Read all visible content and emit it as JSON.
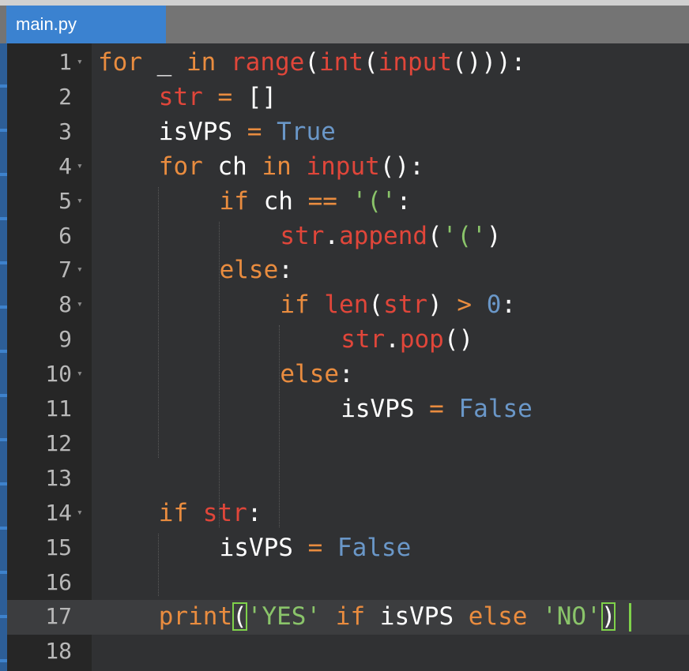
{
  "editor": {
    "tab": {
      "label": "main.py"
    },
    "lines": [
      {
        "number": "1",
        "fold": true,
        "indent": 0,
        "tokens": [
          {
            "t": "for",
            "c": "kw"
          },
          {
            "t": " _ ",
            "c": "pl"
          },
          {
            "t": "in",
            "c": "kw"
          },
          {
            "t": " ",
            "c": "pl"
          },
          {
            "t": "range",
            "c": "bi"
          },
          {
            "t": "(",
            "c": "pl"
          },
          {
            "t": "int",
            "c": "bi"
          },
          {
            "t": "(",
            "c": "pl"
          },
          {
            "t": "input",
            "c": "bi"
          },
          {
            "t": "())):",
            "c": "pl"
          }
        ]
      },
      {
        "number": "2",
        "fold": false,
        "indent": 1,
        "tokens": [
          {
            "t": "str",
            "c": "bi"
          },
          {
            "t": " ",
            "c": "pl"
          },
          {
            "t": "=",
            "c": "op"
          },
          {
            "t": " []",
            "c": "pl"
          }
        ]
      },
      {
        "number": "3",
        "fold": false,
        "indent": 1,
        "tokens": [
          {
            "t": "isVPS ",
            "c": "pl"
          },
          {
            "t": "=",
            "c": "op"
          },
          {
            "t": " ",
            "c": "pl"
          },
          {
            "t": "True",
            "c": "bo"
          }
        ]
      },
      {
        "number": "4",
        "fold": true,
        "indent": 1,
        "tokens": [
          {
            "t": "for",
            "c": "kw"
          },
          {
            "t": " ch ",
            "c": "pl"
          },
          {
            "t": "in",
            "c": "kw"
          },
          {
            "t": " ",
            "c": "pl"
          },
          {
            "t": "input",
            "c": "bi"
          },
          {
            "t": "():",
            "c": "pl"
          }
        ]
      },
      {
        "number": "5",
        "fold": true,
        "indent": 2,
        "tokens": [
          {
            "t": "if",
            "c": "kw"
          },
          {
            "t": " ch ",
            "c": "pl"
          },
          {
            "t": "==",
            "c": "op"
          },
          {
            "t": " ",
            "c": "pl"
          },
          {
            "t": "'('",
            "c": "st"
          },
          {
            "t": ":",
            "c": "pl"
          }
        ]
      },
      {
        "number": "6",
        "fold": false,
        "indent": 3,
        "tokens": [
          {
            "t": "str",
            "c": "bi"
          },
          {
            "t": ".",
            "c": "pl"
          },
          {
            "t": "append",
            "c": "bi"
          },
          {
            "t": "(",
            "c": "pl"
          },
          {
            "t": "'('",
            "c": "st"
          },
          {
            "t": ")",
            "c": "pl"
          }
        ]
      },
      {
        "number": "7",
        "fold": true,
        "indent": 2,
        "tokens": [
          {
            "t": "else",
            "c": "kw"
          },
          {
            "t": ":",
            "c": "pl"
          }
        ]
      },
      {
        "number": "8",
        "fold": true,
        "indent": 3,
        "tokens": [
          {
            "t": "if",
            "c": "kw"
          },
          {
            "t": " ",
            "c": "pl"
          },
          {
            "t": "len",
            "c": "bi"
          },
          {
            "t": "(",
            "c": "pl"
          },
          {
            "t": "str",
            "c": "bi"
          },
          {
            "t": ") ",
            "c": "pl"
          },
          {
            "t": ">",
            "c": "op"
          },
          {
            "t": " ",
            "c": "pl"
          },
          {
            "t": "0",
            "c": "nm"
          },
          {
            "t": ":",
            "c": "pl"
          }
        ]
      },
      {
        "number": "9",
        "fold": false,
        "indent": 4,
        "tokens": [
          {
            "t": "str",
            "c": "bi"
          },
          {
            "t": ".",
            "c": "pl"
          },
          {
            "t": "pop",
            "c": "bi"
          },
          {
            "t": "()",
            "c": "pl"
          }
        ]
      },
      {
        "number": "10",
        "fold": true,
        "indent": 3,
        "tokens": [
          {
            "t": "else",
            "c": "kw"
          },
          {
            "t": ":",
            "c": "pl"
          }
        ]
      },
      {
        "number": "11",
        "fold": false,
        "indent": 4,
        "tokens": [
          {
            "t": "isVPS ",
            "c": "pl"
          },
          {
            "t": "=",
            "c": "op"
          },
          {
            "t": " ",
            "c": "pl"
          },
          {
            "t": "False",
            "c": "bo"
          }
        ]
      },
      {
        "number": "12",
        "fold": false,
        "indent": 0,
        "tokens": []
      },
      {
        "number": "13",
        "fold": false,
        "indent": 0,
        "tokens": []
      },
      {
        "number": "14",
        "fold": true,
        "indent": 1,
        "tokens": [
          {
            "t": "if",
            "c": "kw"
          },
          {
            "t": " ",
            "c": "pl"
          },
          {
            "t": "str",
            "c": "bi"
          },
          {
            "t": ":",
            "c": "pl"
          }
        ]
      },
      {
        "number": "15",
        "fold": false,
        "indent": 2,
        "tokens": [
          {
            "t": "isVPS ",
            "c": "pl"
          },
          {
            "t": "=",
            "c": "op"
          },
          {
            "t": " ",
            "c": "pl"
          },
          {
            "t": "False",
            "c": "bo"
          }
        ]
      },
      {
        "number": "16",
        "fold": false,
        "indent": 0,
        "tokens": []
      },
      {
        "number": "17",
        "fold": false,
        "indent": 1,
        "active": true,
        "tokens": [
          {
            "t": "print",
            "c": "kw"
          },
          {
            "t": "(",
            "c": "pl",
            "match": true
          },
          {
            "t": "'YES'",
            "c": "st"
          },
          {
            "t": " ",
            "c": "pl"
          },
          {
            "t": "if",
            "c": "kw"
          },
          {
            "t": " isVPS ",
            "c": "pl"
          },
          {
            "t": "else",
            "c": "kw"
          },
          {
            "t": " ",
            "c": "pl"
          },
          {
            "t": "'NO'",
            "c": "st"
          },
          {
            "t": ")",
            "c": "pl",
            "match": true
          }
        ]
      },
      {
        "number": "18",
        "fold": false,
        "indent": 0,
        "tokens": []
      }
    ]
  },
  "colors": {
    "keyword": "#e98c3f",
    "builtin": "#e0463a",
    "boolean": "#6a97c8",
    "string": "#8ac46a",
    "text": "#ffffff",
    "tab_active": "#3b82d0",
    "background": "#303133",
    "gutter": "#262626",
    "cursor": "#7fd24a"
  },
  "icons": {
    "fold": "chevron-down-icon"
  }
}
